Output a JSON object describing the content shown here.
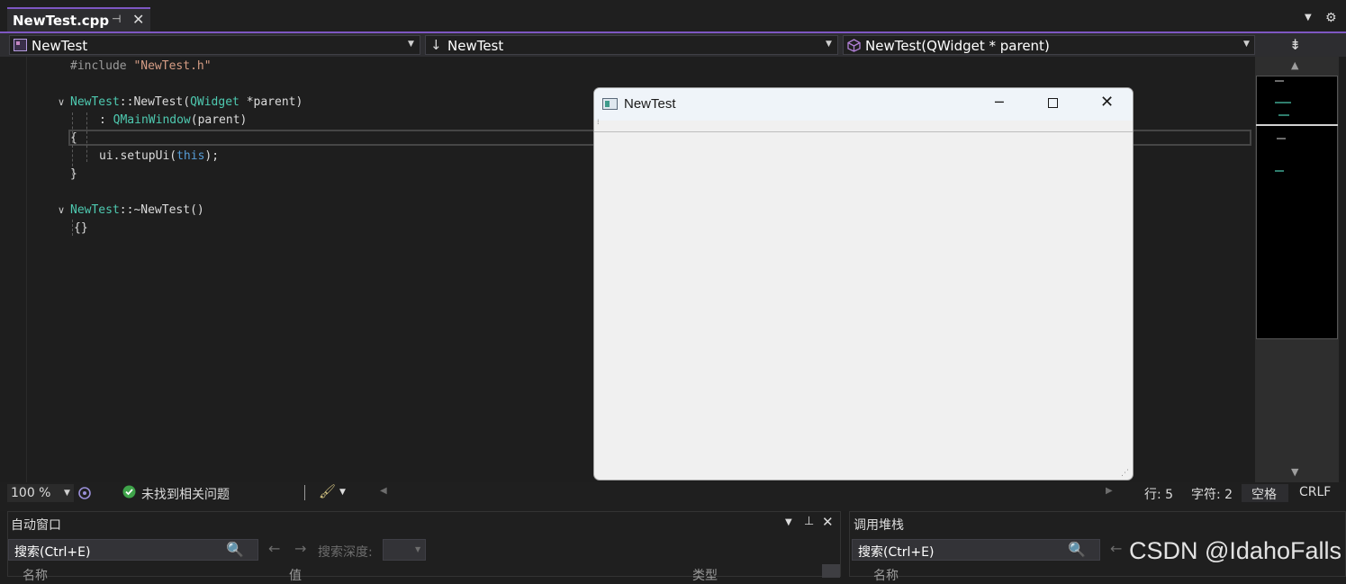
{
  "tab": {
    "title": "NewTest.cpp",
    "pin_icon": "pin-icon",
    "close_icon": "close-icon"
  },
  "navbar": {
    "project": "NewTest",
    "scope": "NewTest",
    "member": "NewTest(QWidget * parent)"
  },
  "code": {
    "l1_directive": "#include",
    "l1_file": "\"NewTest.h\"",
    "l3_class": "NewTest",
    "l3_sep": "::",
    "l3_fn": "NewTest",
    "l3_open": "(",
    "l3_type": "QWidget",
    "l3_param": " *parent)",
    "l4_colon": ": ",
    "l4_type": "QMainWindow",
    "l4_arg": "(parent)",
    "l5": "{",
    "l6_call": "ui.setupUi(",
    "l6_this": "this",
    "l6_end": ");",
    "l7": "}",
    "l9_class": "NewTest",
    "l9_rest": "::~NewTest()",
    "l10": "{}"
  },
  "status": {
    "zoom": "100 %",
    "issues": "未找到相关问题",
    "line": "行: 5",
    "char": "字符: 2",
    "spacing": "空格",
    "eol": "CRLF"
  },
  "autos": {
    "title": "自动窗口",
    "search_placeholder": "搜索(Ctrl+E)",
    "depth_label": "搜索深度:",
    "col_name": "名称",
    "col_value": "值",
    "col_type": "类型"
  },
  "callstack": {
    "title": "调用堆栈",
    "search_placeholder": "搜索(Ctrl+E)",
    "col_name": "名称"
  },
  "qt_window": {
    "title": "NewTest"
  },
  "watermark": "CSDN @IdahoFalls"
}
